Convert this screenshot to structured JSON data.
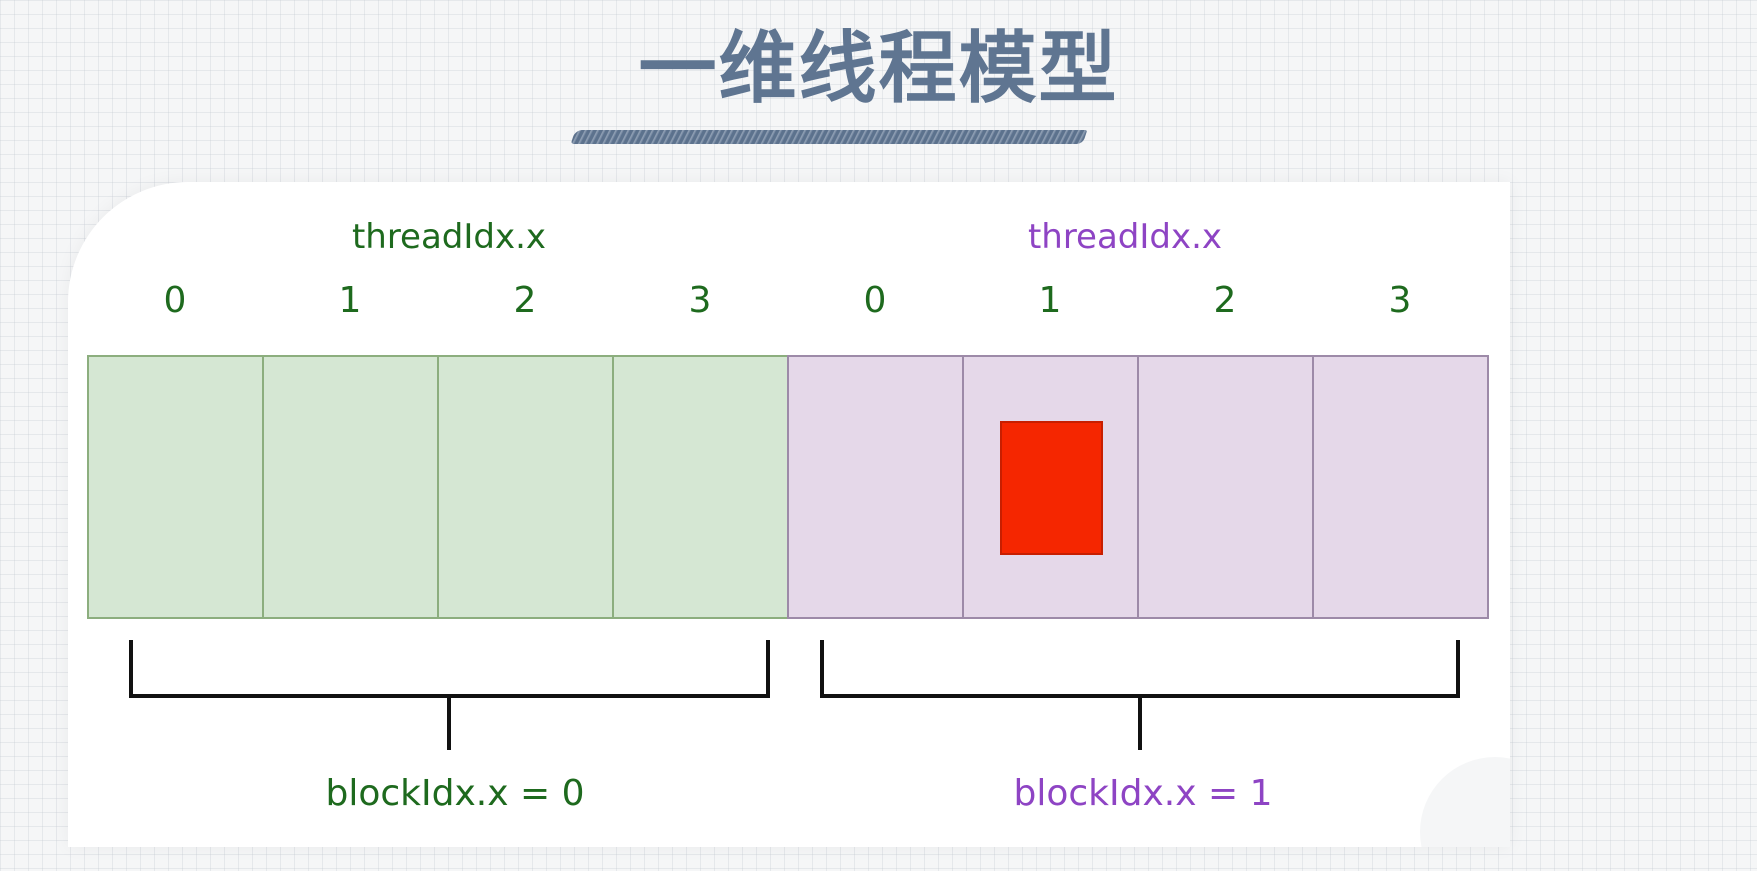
{
  "title": "一维线程模型",
  "colors": {
    "title": "#5f7591",
    "block0_fill": "#d5e7d3",
    "block0_stroke": "#8cae7e",
    "block0_text": "#1e6a1e",
    "block1_fill": "#e5d8e9",
    "block1_stroke": "#9d8aa8",
    "block1_text": "#8e44c4",
    "highlight": "#f52600",
    "brace": "#111111"
  },
  "blocks": [
    {
      "thread_label": "threadIdx.x",
      "indices": [
        "0",
        "1",
        "2",
        "3"
      ],
      "block_label": "blockIdx.x = 0"
    },
    {
      "thread_label": "threadIdx.x",
      "indices": [
        "0",
        "1",
        "2",
        "3"
      ],
      "block_label": "blockIdx.x = 1"
    }
  ],
  "highlighted_thread": {
    "block": 1,
    "thread": 1
  }
}
